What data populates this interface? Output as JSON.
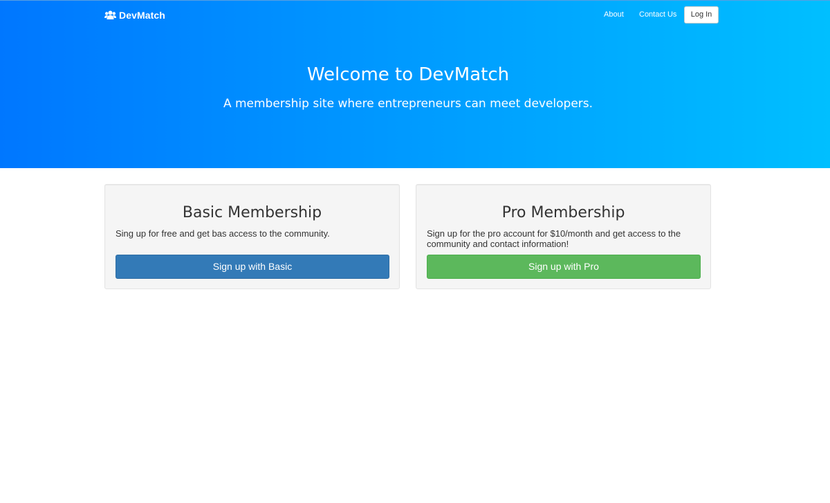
{
  "nav": {
    "brand": "DevMatch",
    "brand_icon": "users-icon",
    "links": [
      {
        "label": "About"
      },
      {
        "label": "Contact Us"
      }
    ],
    "login_label": "Log In"
  },
  "hero": {
    "title": "Welcome to DevMatch",
    "subtitle": "A membership site where entrepreneurs can meet developers.",
    "gradient_start": "#0077ff",
    "gradient_end": "#00bfff"
  },
  "plans": [
    {
      "title": "Basic Membership",
      "description": "Sing up for free and get bas access to the community.",
      "button_label": "Sign up with Basic",
      "button_color": "#337ab7"
    },
    {
      "title": "Pro Membership",
      "description": "Sign up for the pro account for $10/month and get access to the community and contact information!",
      "button_label": "Sign up with Pro",
      "button_color": "#5cb85c"
    }
  ]
}
